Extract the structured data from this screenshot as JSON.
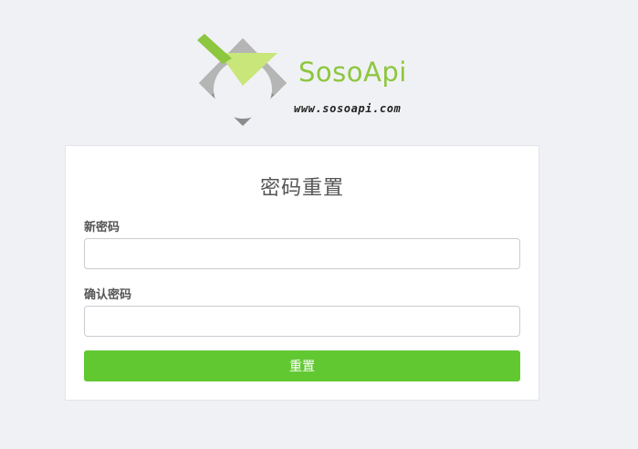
{
  "logo": {
    "name": "SosoApi",
    "url_text": "www.sosoapi.com",
    "brand_color": "#8dc63f",
    "icon": "sosoapi-logo-icon"
  },
  "form": {
    "title": "密码重置",
    "new_password_label": "新密码",
    "new_password_value": "",
    "confirm_password_label": "确认密码",
    "confirm_password_value": "",
    "submit_label": "重置",
    "submit_color": "#62c832"
  },
  "colors": {
    "background": "#f0f1f4",
    "card": "#ffffff"
  }
}
